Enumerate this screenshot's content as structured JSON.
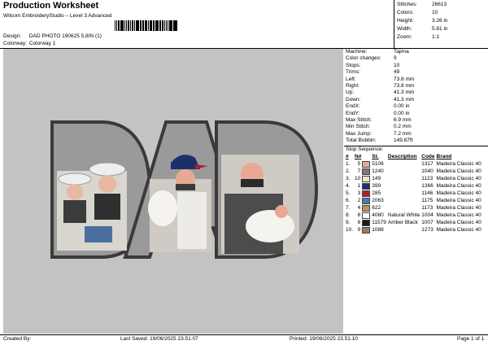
{
  "header": {
    "title": "Production Worksheet",
    "software": "Wilcom EmbroideryStudio – Level 3 Advanced",
    "design_label": "Design:",
    "design_value": "DAD PHOTO 190625 5,8IN (1)",
    "colorway_label": "Colorway:",
    "colorway_value": "Colorway 1"
  },
  "stats": [
    {
      "label": "Stitches:",
      "value": "26613"
    },
    {
      "label": "Colors:",
      "value": "10"
    },
    {
      "label": "Height:",
      "value": "3.26 in"
    },
    {
      "label": "Width:",
      "value": "5.81 in"
    },
    {
      "label": "Zoom:",
      "value": "1:1"
    }
  ],
  "machine_info": [
    {
      "label": "Machine:",
      "value": "Tajima"
    },
    {
      "label": "Color changes:",
      "value": "9"
    },
    {
      "label": "Stops:",
      "value": "10"
    },
    {
      "label": "Trims:",
      "value": "49"
    },
    {
      "label": "Left:",
      "value": "73.8 mm"
    },
    {
      "label": "Right:",
      "value": "73.8 mm"
    },
    {
      "label": "Up:",
      "value": "41.3 mm"
    },
    {
      "label": "Down:",
      "value": "41.3 mm"
    },
    {
      "label": "EndX:",
      "value": "0.00 in"
    },
    {
      "label": "EndY:",
      "value": "0.00 in"
    },
    {
      "label": "Max Stitch:",
      "value": "6.9 mm"
    },
    {
      "label": "Min Stitch:",
      "value": "0.2 mm"
    },
    {
      "label": "Max Jump:",
      "value": "7.2 mm"
    },
    {
      "label": "Total Bobbin:",
      "value": "149.87ft"
    }
  ],
  "stop_sequence": {
    "title": "Stop Sequence:",
    "headers": [
      "#",
      "N#",
      "St.",
      "Description",
      "Code",
      "Brand"
    ],
    "rows": [
      {
        "idx": "1.",
        "n": "5",
        "color": "#e8a894",
        "st": "5106",
        "desc": "",
        "code": "1317",
        "brand": "Madeira Classic 40"
      },
      {
        "idx": "2.",
        "n": "7",
        "color": "#7b7b7b",
        "st": "1240",
        "desc": "",
        "code": "1040",
        "brand": "Madeira Classic 40"
      },
      {
        "idx": "3.",
        "n": "10",
        "color": "#f1e7c8",
        "st": "149",
        "desc": "",
        "code": "1123",
        "brand": "Madeira Classic 40"
      },
      {
        "idx": "4.",
        "n": "1",
        "color": "#1d2f6b",
        "st": "399",
        "desc": "",
        "code": "1366",
        "brand": "Madeira Classic 40"
      },
      {
        "idx": "5.",
        "n": "3",
        "color": "#b0202a",
        "st": "285",
        "desc": "",
        "code": "1146",
        "brand": "Madeira Classic 40"
      },
      {
        "idx": "6.",
        "n": "2",
        "color": "#4a79b8",
        "st": "2063",
        "desc": "",
        "code": "1175",
        "brand": "Madeira Classic 40"
      },
      {
        "idx": "7.",
        "n": "4",
        "color": "#c98d5a",
        "st": "622",
        "desc": "",
        "code": "1173",
        "brand": "Madeira Classic 40"
      },
      {
        "idx": "8.",
        "n": "8",
        "color": "#ffffff",
        "st": "4080",
        "desc": "Natural White",
        "code": "1004",
        "brand": "Madeira Classic 40"
      },
      {
        "idx": "9.",
        "n": "6",
        "color": "#1a1a1a",
        "st": "11579",
        "desc": "Amber Black",
        "code": "1007",
        "brand": "Madeira Classic 40"
      },
      {
        "idx": "10.",
        "n": "9",
        "color": "#9c7a55",
        "st": "1088",
        "desc": "",
        "code": "1273",
        "brand": "Madeira Classic 40"
      }
    ]
  },
  "footer": {
    "created_by": "Created By:",
    "last_saved": "Last Saved: 19/06/2025 23.51.07",
    "printed": "Printed: 19/06/2025 23.51.10",
    "page": "Page 1 of 1"
  },
  "design_art": {
    "letters": [
      "D",
      "A",
      "D"
    ],
    "outline_color": "#3a3a3a",
    "fill_color": "#9a9a9a",
    "background_color": "#c3c3c3"
  }
}
